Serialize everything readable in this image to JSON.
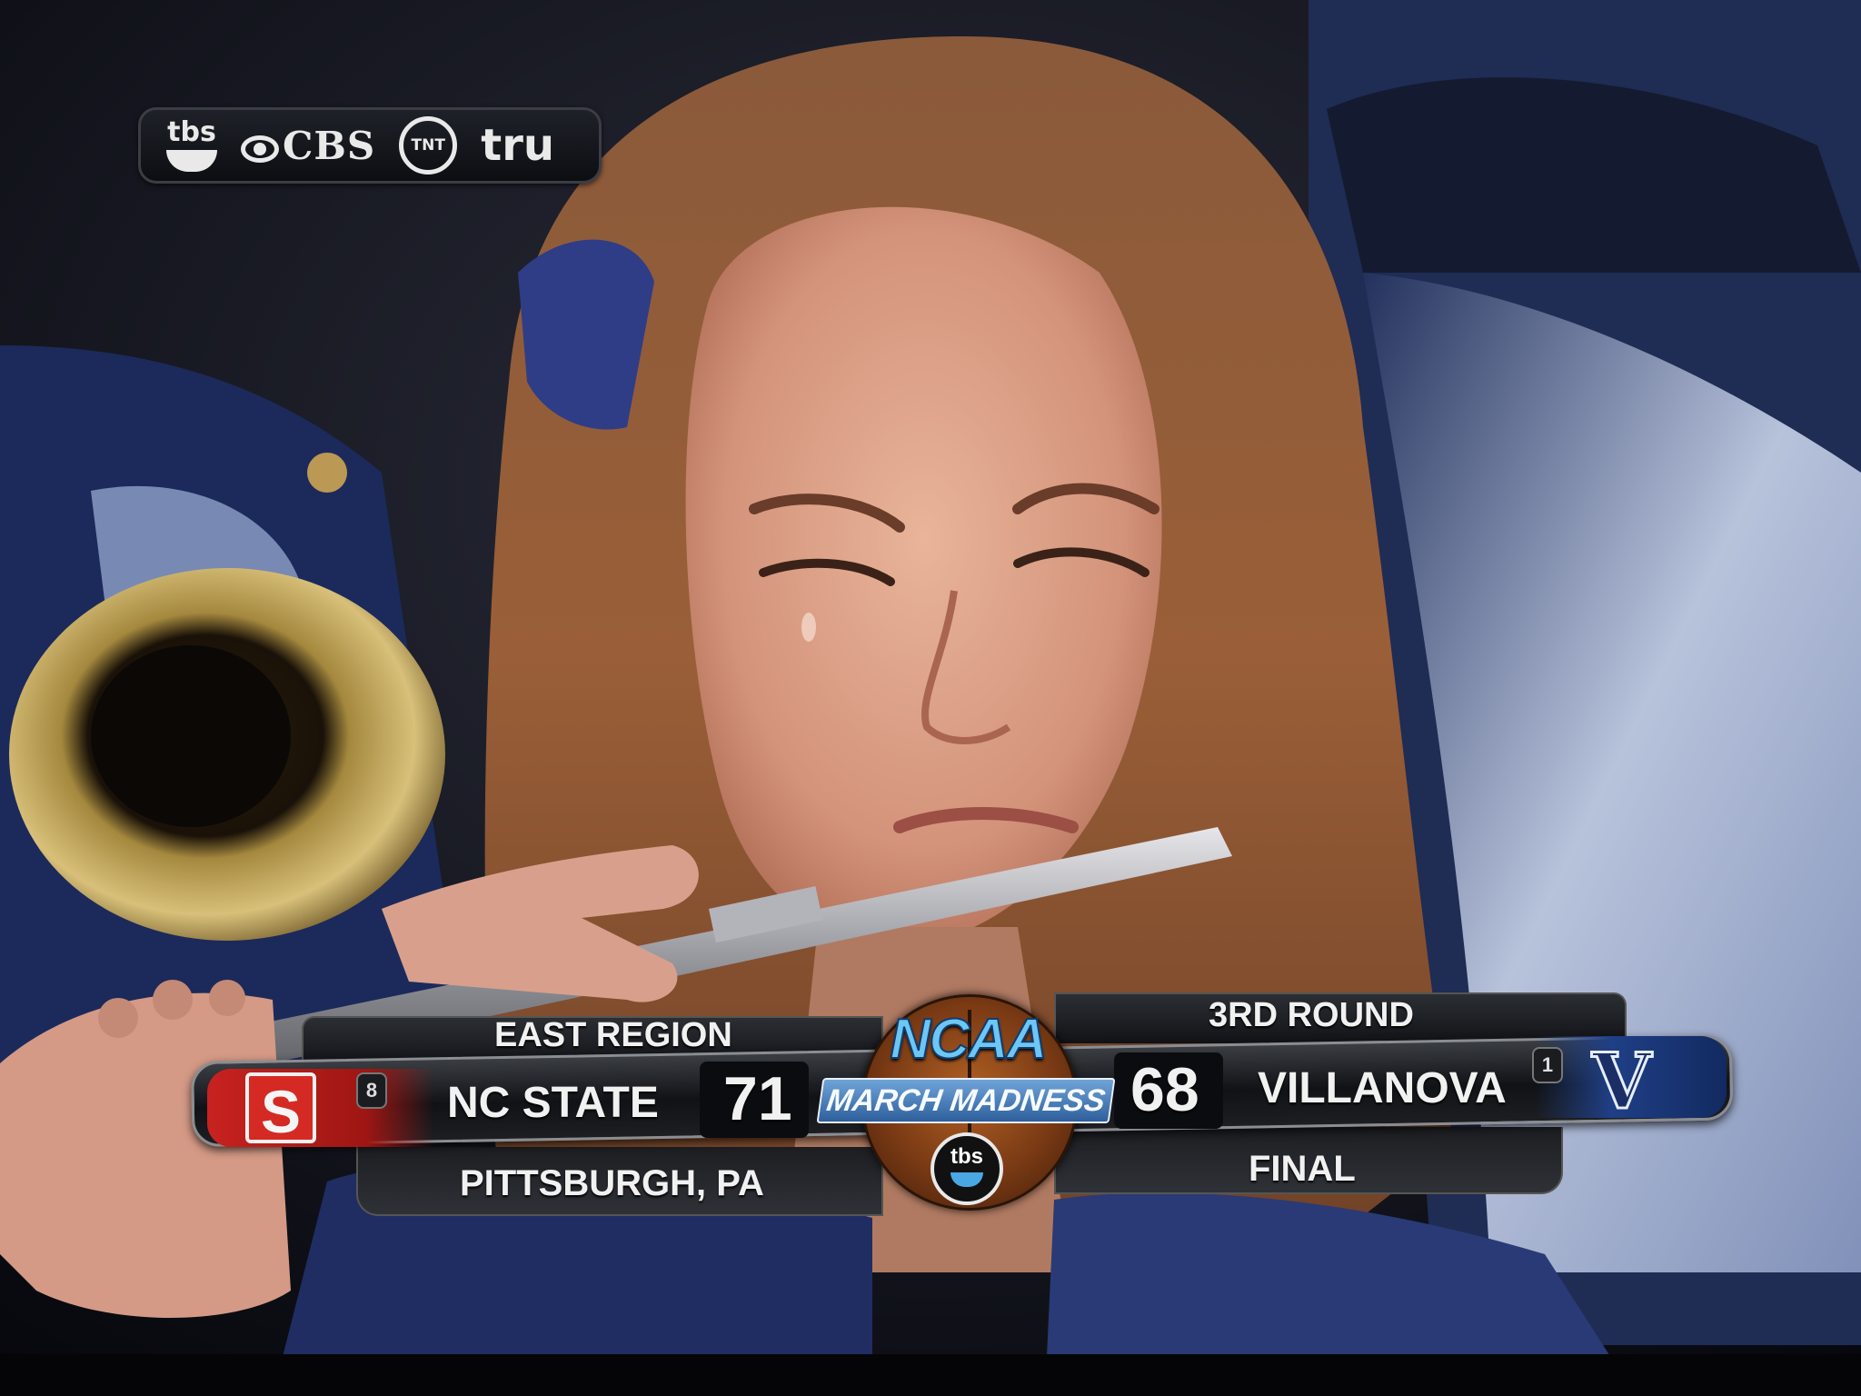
{
  "network_bug": {
    "networks": [
      "tbs",
      "CBS",
      "TNT",
      "tru"
    ]
  },
  "scorebug": {
    "region": "EAST REGION",
    "round": "3RD ROUND",
    "location": "PITTSBURGH, PA",
    "status": "FINAL",
    "left_team": {
      "name": "NC STATE",
      "seed": "8",
      "score": "71",
      "logo_letter": "S"
    },
    "right_team": {
      "name": "VILLANOVA",
      "seed": "1",
      "score": "68",
      "logo_letter": "V"
    },
    "center_logo": {
      "top": "NCAA",
      "bottom": "MARCH MADNESS",
      "broadcaster": "tbs"
    }
  },
  "colors": {
    "nc_state_red": "#c8221f",
    "villanova_navy": "#1f3f86",
    "ncaa_blue": "#6ec6f4"
  }
}
